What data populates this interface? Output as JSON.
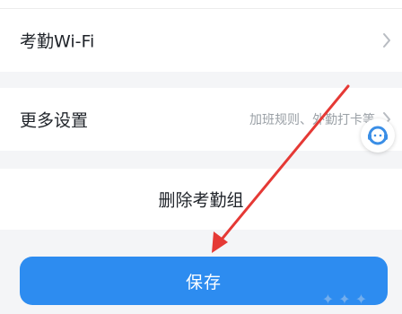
{
  "rows": {
    "wifi": {
      "label": "考勤Wi-Fi"
    },
    "more": {
      "label": "更多设置",
      "hint": "加班规则、外勤打卡等"
    },
    "delete": {
      "label": "删除考勤组"
    }
  },
  "save_button": {
    "label": "保存"
  },
  "icons": {
    "chevron": "chevron-right-icon",
    "service": "customer-service-icon",
    "arrow": "red-annotation-arrow"
  },
  "colors": {
    "accent": "#2d8cf0",
    "annotation": "#e53935"
  }
}
